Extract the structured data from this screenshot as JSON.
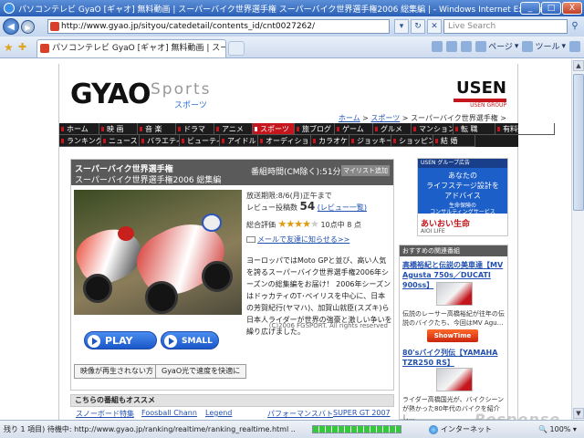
{
  "window": {
    "title": "パソコンテレビ GyaO [ギャオ] 無料動画 | スーパーバイク世界選手権 スーパーバイク世界選手権2006 総集編 | - Windows Internet Explorer",
    "minimize": "_",
    "maximize": "□",
    "close": "X"
  },
  "addressbar": {
    "url": "http://www.gyao.jp/sityou/catedetail/contents_id/cnt0027262/",
    "search_placeholder": "Live Search"
  },
  "tabs": [
    {
      "label": "パソコンテレビ GyaO [ギャオ] 無料動画 | スーパーバイ..."
    }
  ],
  "commands": {
    "page": "ページ",
    "tools": "ツール"
  },
  "header": {
    "logo": "GYAO",
    "sports_en": "Sports",
    "sports_ja": "スポーツ",
    "usen": "USEN",
    "usen_group": "USEN GROUP"
  },
  "breadcrumb": {
    "home": "ホーム",
    "sep": " > ",
    "sports": "スポーツ",
    "current": "スーパーバイク世界選手権 >"
  },
  "global_nav": {
    "row1": [
      "ホーム",
      "映 画",
      "音 楽",
      "ドラマ",
      "アニメ",
      "スポーツ",
      "旅ブログ",
      "ゲーム",
      "グルメ",
      "マンション",
      "転 職",
      "有料動画"
    ],
    "row2": [
      "ランキング",
      "ニュース",
      "バラエティ",
      "ビューティ",
      "アイドル",
      "オーディション",
      "カラオケ",
      "ジョッキー",
      "ショッピング",
      "結 婚"
    ],
    "active_index": 5
  },
  "main": {
    "title": "スーパーバイク世界選手権",
    "subtitle": "スーパーバイク世界選手権2006 総集編",
    "runtime": "番組時間(CM除く):51分44秒",
    "mylist": "マイリスト追加",
    "broadcast_end": "放送期限:8/6(月)正午まで",
    "review_label": "レビュー投稿数",
    "review_count": "54",
    "review_link": "(レビュー一覧)",
    "rating_label": "総合評価",
    "rating_value": 4,
    "rating_max": 5,
    "rating_note": "10点中 8 点",
    "mail_link": "メールで友達に知らせる>>",
    "description": "ヨーロッパではMoto GPと並び、高い人気を誇るスーパーバイク世界選手権2006年シーズンの総集編をお届け！ 2006年シーズンはドゥカティのT･ベイリスを中心に、日本の芳賀紀行(ヤマハ)、加賀山就臣(スズキ)ら日本人ライダーが世界の強豪と激しい争いを繰り広げました。",
    "copyright": "(C)2006 FGSPORT. All rights reserved",
    "play_label": "PLAY",
    "small_label": "SMALL",
    "help1": "映像が再生されない方",
    "help2": "GyaO光で速度を快適に"
  },
  "recommend": {
    "heading": "こちらの番組もオススメ",
    "items": [
      "スノーボード特集",
      "Foosball Chann",
      "Legend",
      "パフォーマンスバト",
      "SUPER GT 2007"
    ]
  },
  "ad": {
    "top": "USEN グループ広告",
    "line1": "あなたの",
    "line2": "ライフステージ設計を",
    "line3": "アドバイス",
    "line4": "生命保険の",
    "line5": "コンサルティングサービス",
    "logo": "あいおい生命",
    "small": "AIOI LIFE"
  },
  "sidebar": {
    "heading": "おすすめの関連番組",
    "items": [
      {
        "title": "高橋裕紀と伝説の美車達【MV Agusta 750s／DUCATI 900ss】",
        "desc": "伝説のレーサー高橋裕紀が往年の伝説のバイクたち、今回はMV Agu…"
      },
      {
        "title": "80'sバイク列伝【YAMAHA TZR250 RS】",
        "desc": "ライダー高橋国光が、バイクシーンが熱かった80年代のバイクを紹介し…"
      }
    ],
    "showtime": "ShowTime"
  },
  "status": {
    "text": "残り 1 項目) 待機中: http://www.gyao.jp/ranking/realtime/ranking_realtime.html ...",
    "progress": 1.0,
    "zone": "インターネット",
    "zoom": "100%"
  },
  "watermark": "Response"
}
